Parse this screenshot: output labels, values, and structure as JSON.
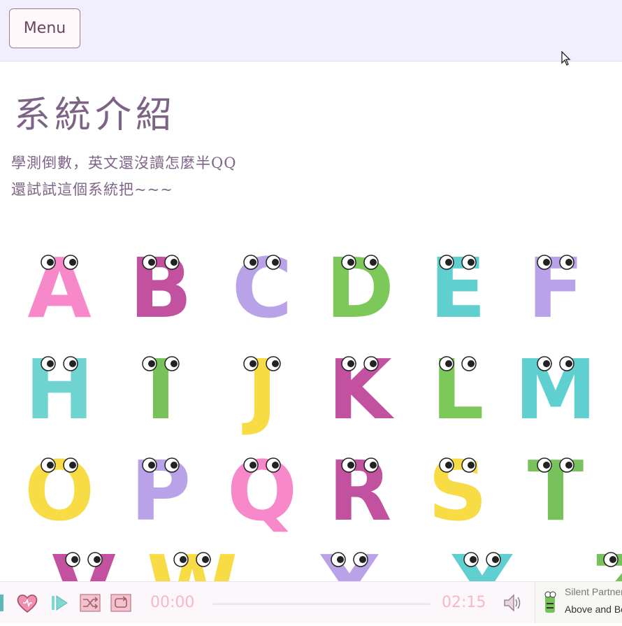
{
  "topbar": {
    "menu_label": "Menu"
  },
  "page": {
    "title": "系統介紹",
    "intro_lines": [
      "學測倒數，英文還沒讀怎麼半QQ",
      "還試試這個系統把~~~"
    ]
  },
  "alphabet": [
    {
      "letter": "A",
      "color": "#f788c9"
    },
    {
      "letter": "B",
      "color": "#c2529f"
    },
    {
      "letter": "C",
      "color": "#b9a2e8"
    },
    {
      "letter": "D",
      "color": "#7cc95a"
    },
    {
      "letter": "E",
      "color": "#5fcfcf"
    },
    {
      "letter": "F",
      "color": "#b9a2e8"
    },
    {
      "letter": "H",
      "color": "#6fd3d0"
    },
    {
      "letter": "I",
      "color": "#77c25a"
    },
    {
      "letter": "J",
      "color": "#f7dc45"
    },
    {
      "letter": "K",
      "color": "#c2529f"
    },
    {
      "letter": "L",
      "color": "#7cc95a"
    },
    {
      "letter": "M",
      "color": "#5fcfcf"
    },
    {
      "letter": "O",
      "color": "#f7dc45"
    },
    {
      "letter": "P",
      "color": "#b9a2e8"
    },
    {
      "letter": "Q",
      "color": "#f788c9"
    },
    {
      "letter": "R",
      "color": "#c2529f"
    },
    {
      "letter": "S",
      "color": "#f7dc45"
    },
    {
      "letter": "T",
      "color": "#77c25a"
    },
    {
      "letter": "V",
      "color": "#c2529f"
    },
    {
      "letter": "W",
      "color": "#f7dc45"
    },
    {
      "letter": "X",
      "color": "#b9a2e8"
    },
    {
      "letter": "Y",
      "color": "#5fcfcf"
    },
    {
      "letter": "Z",
      "color": "#77c25a"
    }
  ],
  "player": {
    "current_time": "00:00",
    "duration": "02:15",
    "progress": 0,
    "accent_color": "#f6b8c8",
    "track_title": "Silent Partner",
    "track_line2": "Above and Beyond",
    "icons": [
      "heart-icon",
      "play-icon",
      "shuffle-icon",
      "repeat-icon",
      "volume-icon"
    ]
  }
}
